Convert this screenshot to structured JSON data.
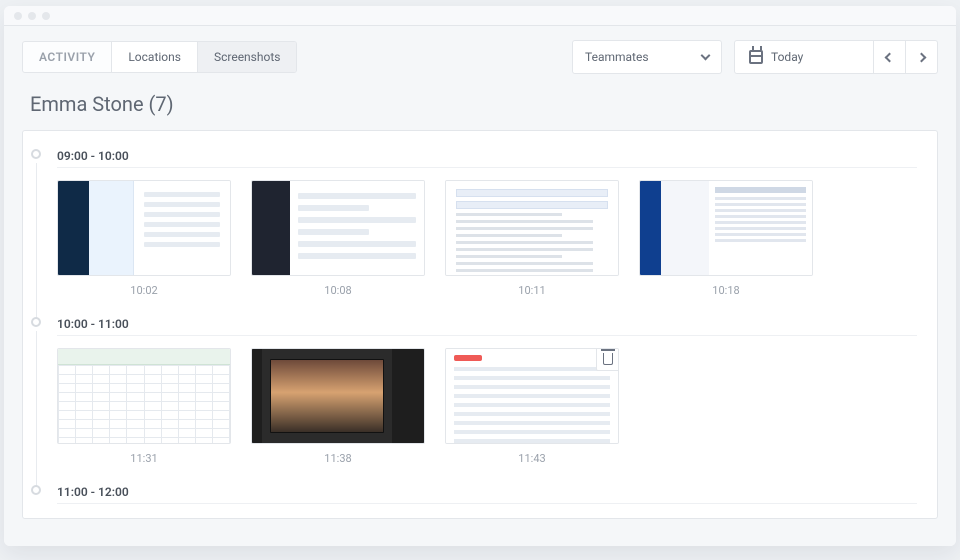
{
  "tabs": {
    "activity": "ACTIVITY",
    "locations": "Locations",
    "screenshots": "Screenshots"
  },
  "filters": {
    "teammates": "Teammates",
    "today": "Today"
  },
  "page_title": "Emma Stone (7)",
  "sections": [
    {
      "range": "09:00 - 10:00",
      "shots": [
        {
          "time": "10:02",
          "kind": "chat"
        },
        {
          "time": "10:08",
          "kind": "slack"
        },
        {
          "time": "10:11",
          "kind": "doc"
        },
        {
          "time": "10:18",
          "kind": "outlook"
        }
      ]
    },
    {
      "range": "10:00 - 11:00",
      "shots": [
        {
          "time": "11:31",
          "kind": "excel"
        },
        {
          "time": "11:38",
          "kind": "ps"
        },
        {
          "time": "11:43",
          "kind": "gmail",
          "deletable": true
        }
      ]
    },
    {
      "range": "11:00 - 12:00",
      "shots": []
    }
  ]
}
